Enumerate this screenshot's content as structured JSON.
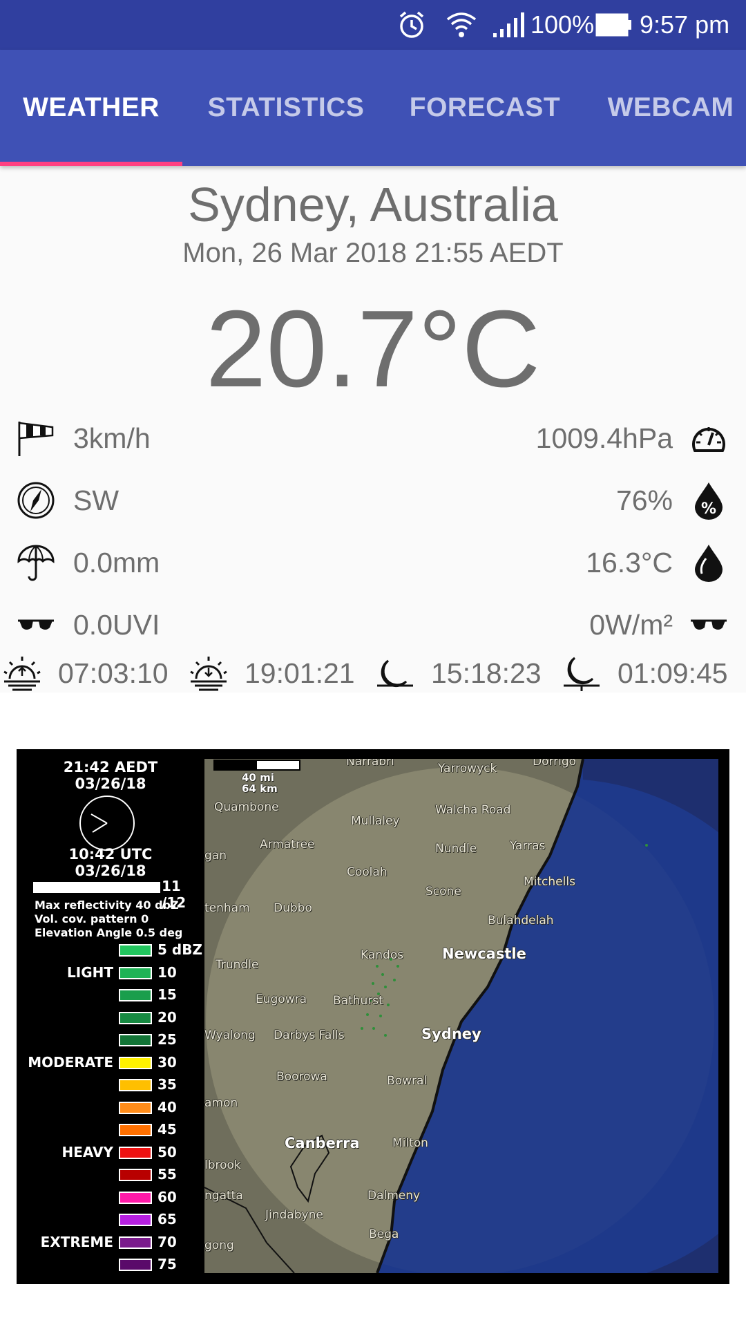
{
  "status_bar": {
    "battery": "100%",
    "time": "9:57 pm",
    "icons": [
      "alarm-icon",
      "wifi-icon",
      "signal-icon",
      "battery-icon"
    ]
  },
  "tabs": [
    {
      "label": "WEATHER",
      "active": true
    },
    {
      "label": "STATISTICS",
      "active": false
    },
    {
      "label": "FORECAST",
      "active": false
    },
    {
      "label": "WEBCAM",
      "active": false
    }
  ],
  "weather": {
    "location": "Sydney, Australia",
    "datetime": "Mon, 26 Mar 2018 21:55 AEDT",
    "temperature": "20.7°C",
    "wind_speed": "3km/h",
    "pressure": "1009.4hPa",
    "wind_direction": "SW",
    "humidity": "76%",
    "rain": "0.0mm",
    "dew_point": "16.3°C",
    "uv": "0.0UVI",
    "solar": "0W/m²",
    "sunrise": "07:03:10",
    "sunset": "19:01:21",
    "moonrise": "15:18:23",
    "moonset": "01:09:45"
  },
  "radar": {
    "local_time": "21:42 AEDT",
    "local_date": "03/26/18",
    "utc_time": "10:42 UTC",
    "utc_date": "03/26/18",
    "frame": "11 /12",
    "max_reflectivity": "Max reflectivity 40 dbZ",
    "vol_cov": "Vol. cov. pattern 0",
    "elevation": "Elevation Angle 0.5 deg",
    "scale_mi": "40 mi",
    "scale_km": "64 km",
    "legend": [
      {
        "value": "5 dBZ",
        "color": "#22c55e",
        "category": ""
      },
      {
        "value": "10",
        "color": "#1fb356",
        "category": "LIGHT"
      },
      {
        "value": "15",
        "color": "#1a9e4c",
        "category": ""
      },
      {
        "value": "20",
        "color": "#178a42",
        "category": ""
      },
      {
        "value": "25",
        "color": "#127436",
        "category": ""
      },
      {
        "value": "30",
        "color": "#fff200",
        "category": "MODERATE"
      },
      {
        "value": "35",
        "color": "#ffbf00",
        "category": ""
      },
      {
        "value": "40",
        "color": "#ff8c1a",
        "category": ""
      },
      {
        "value": "45",
        "color": "#ff7000",
        "category": ""
      },
      {
        "value": "50",
        "color": "#ee1111",
        "category": "HEAVY"
      },
      {
        "value": "55",
        "color": "#b80000",
        "category": ""
      },
      {
        "value": "60",
        "color": "#ff1aa8",
        "category": ""
      },
      {
        "value": "65",
        "color": "#b620e0",
        "category": ""
      },
      {
        "value": "70",
        "color": "#7a1a8c",
        "category": "EXTREME"
      },
      {
        "value": "75",
        "color": "#5a0a6a",
        "category": ""
      }
    ],
    "places": [
      {
        "name": "Narrabri",
        "big": false
      },
      {
        "name": "Yarrowyck",
        "big": false
      },
      {
        "name": "Dorrigo",
        "big": false
      },
      {
        "name": "Quambone",
        "big": false
      },
      {
        "name": "Mullaley",
        "big": false
      },
      {
        "name": "Walcha Road",
        "big": false
      },
      {
        "name": "Armatree",
        "big": false
      },
      {
        "name": "Nundle",
        "big": false
      },
      {
        "name": "Yarras",
        "big": false
      },
      {
        "name": "gan",
        "big": false
      },
      {
        "name": "Coolah",
        "big": false
      },
      {
        "name": "Mitchells",
        "big": false
      },
      {
        "name": "Scone",
        "big": false
      },
      {
        "name": "tenham",
        "big": false
      },
      {
        "name": "Dubbo",
        "big": false
      },
      {
        "name": "Bulahdelah",
        "big": false
      },
      {
        "name": "Kandos",
        "big": false
      },
      {
        "name": "Newcastle",
        "big": true
      },
      {
        "name": "Trundle",
        "big": false
      },
      {
        "name": "Eugowra",
        "big": false
      },
      {
        "name": "Bathurst",
        "big": false
      },
      {
        "name": "Sydney",
        "big": true
      },
      {
        "name": "Wyalong",
        "big": false
      },
      {
        "name": "Darbys Falls",
        "big": false
      },
      {
        "name": "Boorowa",
        "big": false
      },
      {
        "name": "Bowral",
        "big": false
      },
      {
        "name": "amon",
        "big": false
      },
      {
        "name": "Canberra",
        "big": true
      },
      {
        "name": "Milton",
        "big": false
      },
      {
        "name": "lbrook",
        "big": false
      },
      {
        "name": "ngatta",
        "big": false
      },
      {
        "name": "Dalmeny",
        "big": false
      },
      {
        "name": "Jindabyne",
        "big": false
      },
      {
        "name": "Bega",
        "big": false
      },
      {
        "name": "gong",
        "big": false
      }
    ]
  }
}
